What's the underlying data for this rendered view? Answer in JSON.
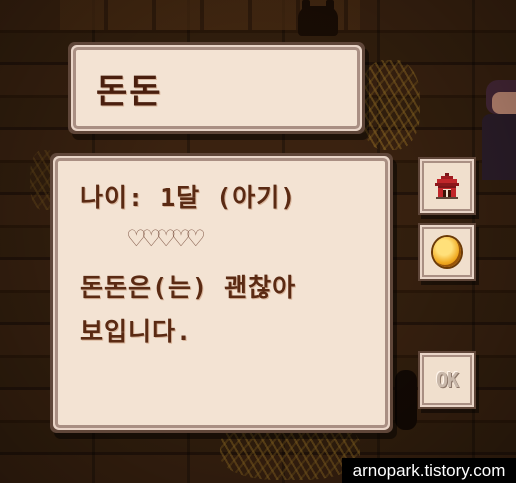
{
  "pet_status_menu": {
    "pet_name": "돈돈",
    "age_text": "나이: 1달 (아기)",
    "hearts_display": "♡♡♡♡♡",
    "friendship_hearts": {
      "filled": 0,
      "total": 5
    },
    "mood_text": "돈돈은(는) 괜찮아\n보입니다."
  },
  "side_buttons": {
    "house_icon": "barn-house-icon",
    "coin_icon": "gold-coin-icon",
    "ok_label": "OK"
  },
  "watermark": {
    "text": "arnopark.tistory.com"
  },
  "colors": {
    "panel_bg": "#f3e3d3",
    "panel_border_dark": "#5f4639",
    "text_brown": "#5a2a13",
    "house_red": "#c0262a",
    "coin_gold": "#f0a81e"
  }
}
